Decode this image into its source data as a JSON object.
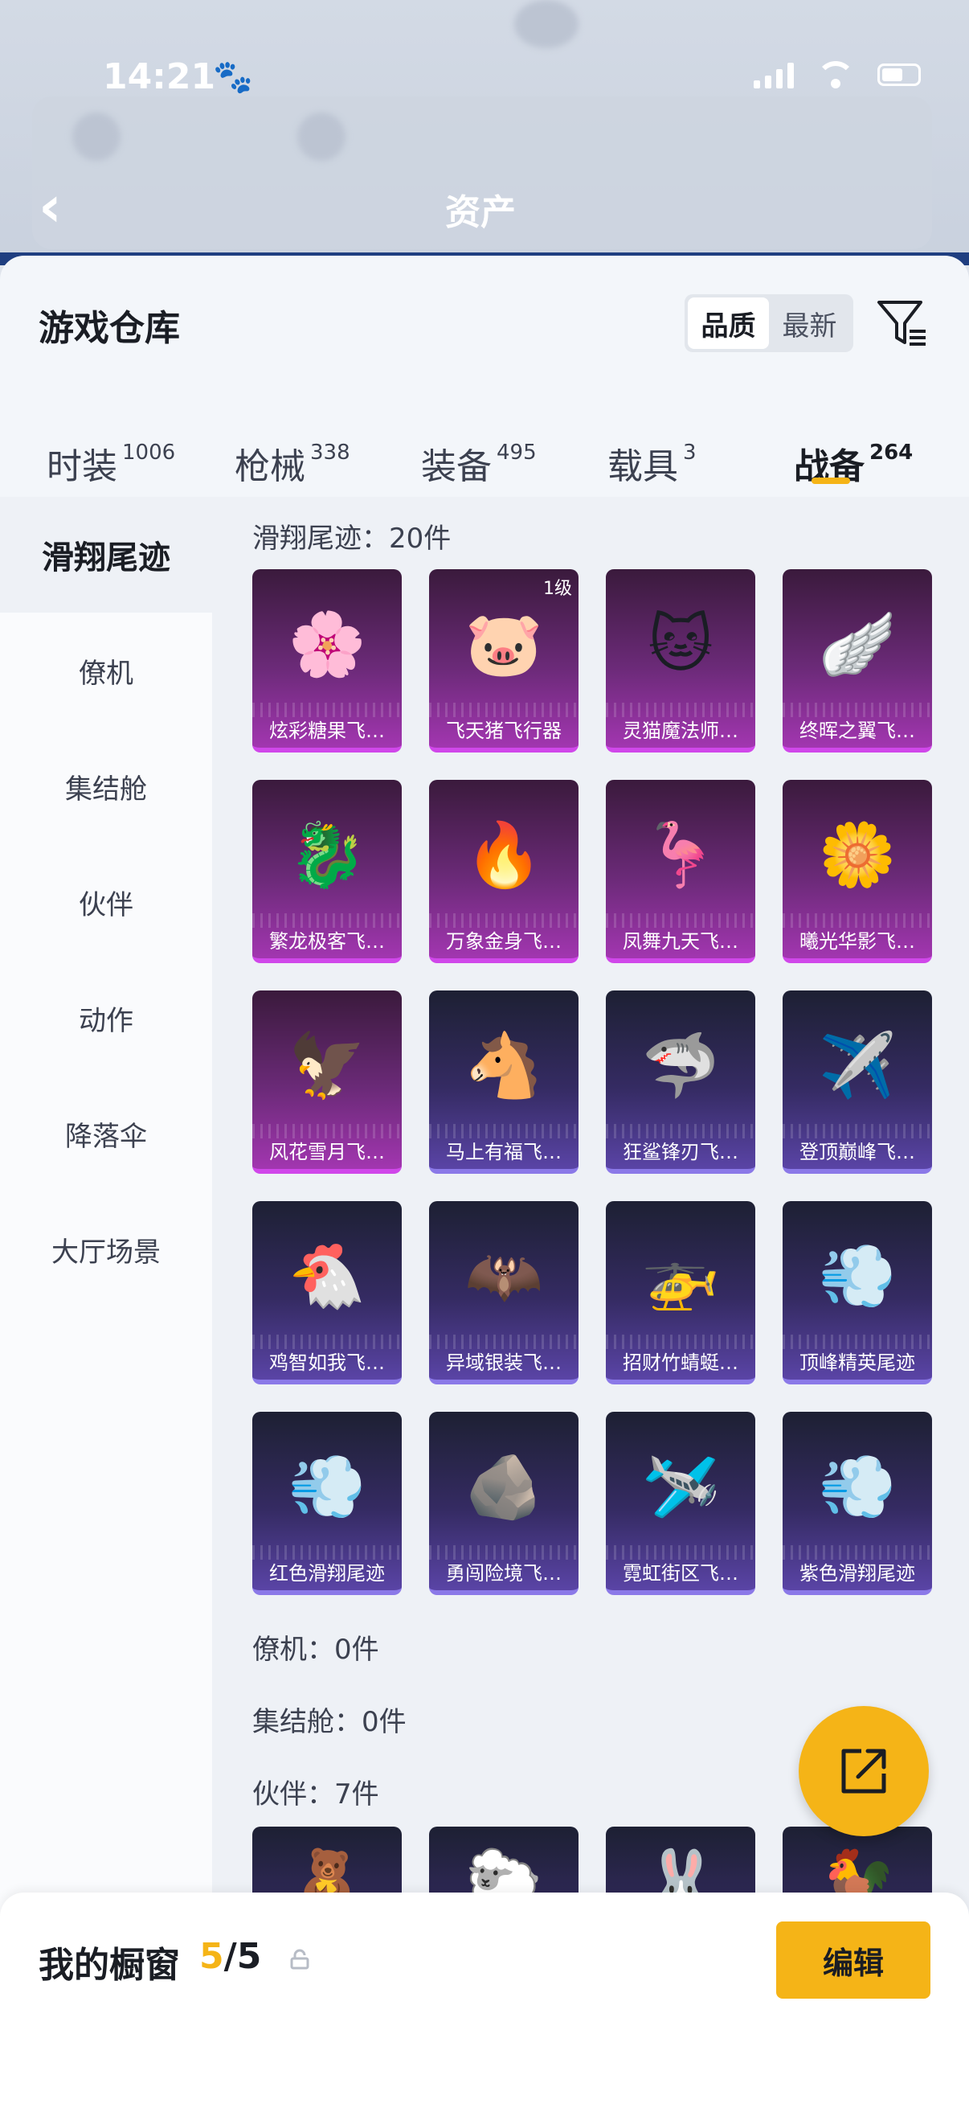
{
  "status_bar": {
    "time": "14:21"
  },
  "header": {
    "title": "资产"
  },
  "sheet": {
    "title": "游戏仓库",
    "sort_options": [
      "品质",
      "最新"
    ],
    "tabs": [
      {
        "label": "时装",
        "count": "1006"
      },
      {
        "label": "枪械",
        "count": "338"
      },
      {
        "label": "装备",
        "count": "495"
      },
      {
        "label": "载具",
        "count": "3"
      },
      {
        "label": "战备",
        "count": "264"
      }
    ]
  },
  "sidebar": {
    "items": [
      "滑翔尾迹",
      "僚机",
      "集结舱",
      "伙伴",
      "动作",
      "降落伞",
      "大厅场景"
    ]
  },
  "sections": {
    "glide": {
      "label": "滑翔尾迹：20件"
    },
    "wingman": {
      "label": "僚机：0件"
    },
    "pod": {
      "label": "集结舱：0件"
    },
    "partner": {
      "label": "伙伴：7件"
    }
  },
  "items": [
    {
      "name": "炫彩糖果飞…",
      "icon": "🌸"
    },
    {
      "name": "飞天猪飞行器",
      "icon": "🐷",
      "level": "1级"
    },
    {
      "name": "灵猫魔法师…",
      "icon": "🐱"
    },
    {
      "name": "终晖之翼飞…",
      "icon": "🪽"
    },
    {
      "name": "繁龙极客飞…",
      "icon": "🐉"
    },
    {
      "name": "万象金身飞…",
      "icon": "🔥"
    },
    {
      "name": "凤舞九天飞…",
      "icon": "🦩"
    },
    {
      "name": "曦光华影飞…",
      "icon": "🌼"
    },
    {
      "name": "风花雪月飞…",
      "icon": "🦅"
    },
    {
      "name": "马上有福飞…",
      "icon": "🐴"
    },
    {
      "name": "狂鲨锋刃飞…",
      "icon": "🦈"
    },
    {
      "name": "登顶巅峰飞…",
      "icon": "✈️"
    },
    {
      "name": "鸡智如我飞…",
      "icon": "🐔"
    },
    {
      "name": "异域银装飞…",
      "icon": "🦇"
    },
    {
      "name": "招财竹蜻蜓…",
      "icon": "🚁"
    },
    {
      "name": "顶峰精英尾迹",
      "icon": "💨"
    },
    {
      "name": "红色滑翔尾迹",
      "icon": "💨"
    },
    {
      "name": "勇闯险境飞…",
      "icon": "🪨"
    },
    {
      "name": "霓虹街区飞…",
      "icon": "🛩️"
    },
    {
      "name": "紫色滑翔尾迹",
      "icon": "💨"
    }
  ],
  "partner_items": [
    {
      "icon": "🧸"
    },
    {
      "icon": "🐑"
    },
    {
      "icon": "🐰"
    },
    {
      "icon": "🐓"
    }
  ],
  "bottom_bar": {
    "title": "我的橱窗",
    "current": "5",
    "total": "/5",
    "edit_label": "编辑"
  },
  "colors": {
    "accent": "#f5b417",
    "purple_rarity": "#d047ea",
    "blue_rarity": "#8b79e8"
  }
}
